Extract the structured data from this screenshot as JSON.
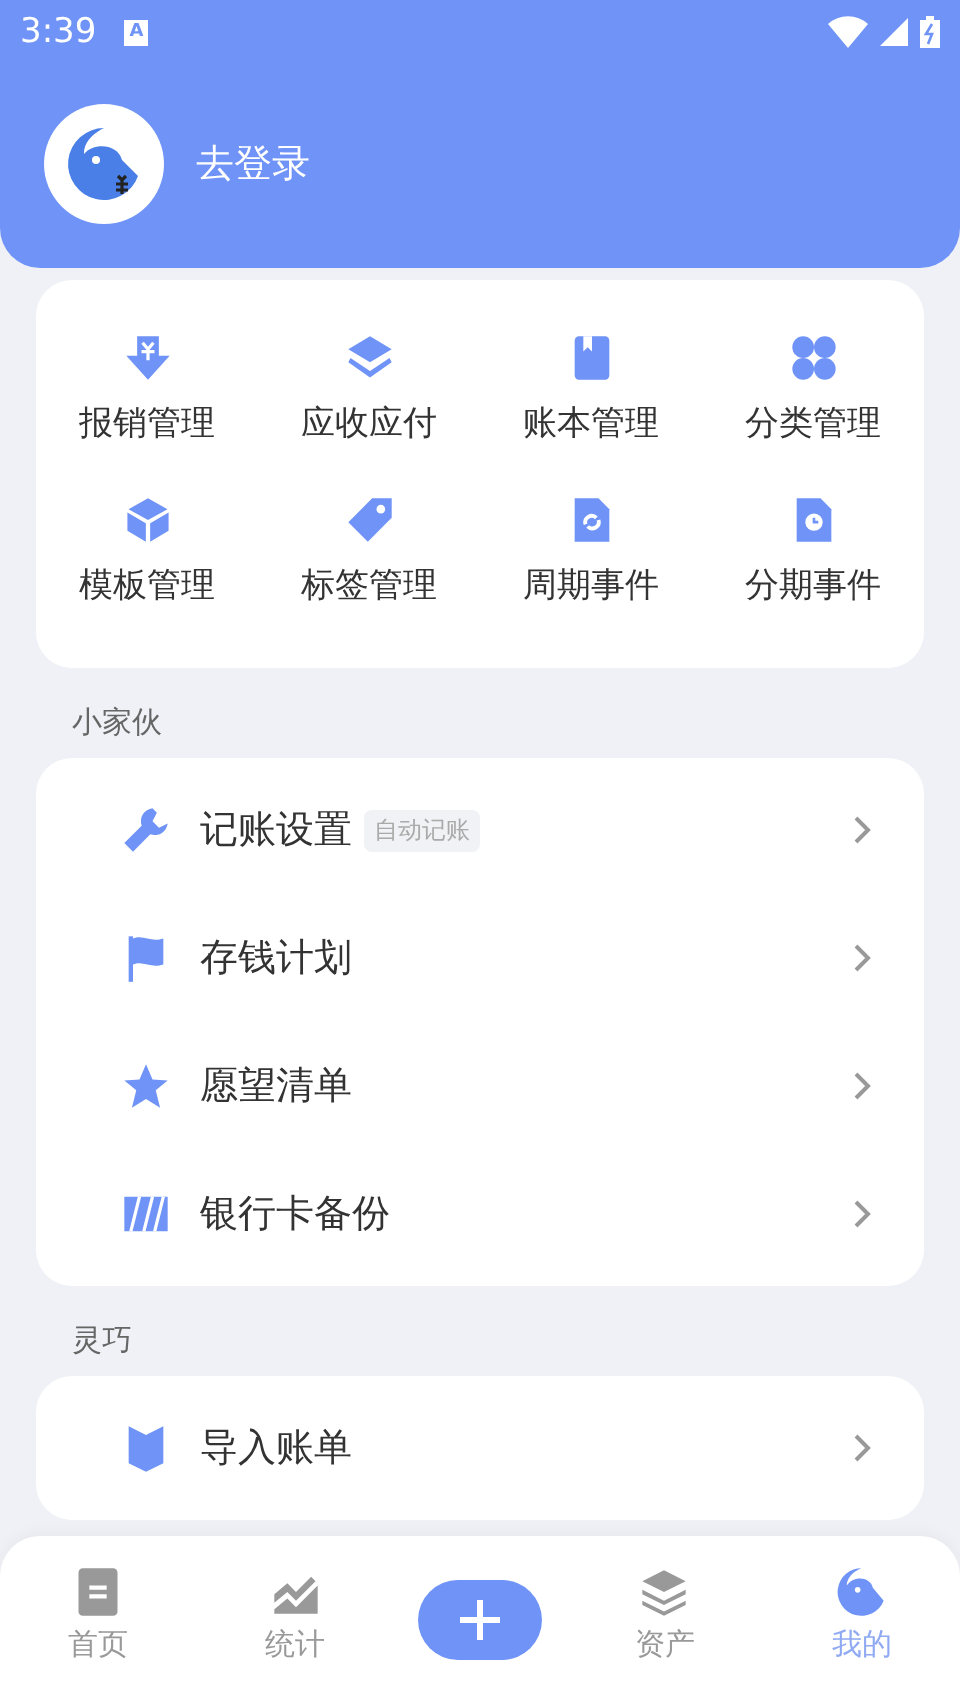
{
  "status_bar": {
    "time": "3:39",
    "notification": "A"
  },
  "profile": {
    "login_label": "去登录"
  },
  "shortcuts": [
    {
      "label": "报销管理",
      "kind": "reimburse"
    },
    {
      "label": "应收应付",
      "kind": "layers"
    },
    {
      "label": "账本管理",
      "kind": "book"
    },
    {
      "label": "分类管理",
      "kind": "clover"
    },
    {
      "label": "模板管理",
      "kind": "cube"
    },
    {
      "label": "标签管理",
      "kind": "tag"
    },
    {
      "label": "周期事件",
      "kind": "cycle"
    },
    {
      "label": "分期事件",
      "kind": "clock"
    }
  ],
  "sections": [
    {
      "title": "小家伙",
      "items": [
        {
          "label": "记账设置",
          "badge": "自动记账",
          "kind": "wrench"
        },
        {
          "label": "存钱计划",
          "kind": "flag"
        },
        {
          "label": "愿望清单",
          "kind": "star"
        },
        {
          "label": "银行卡备份",
          "kind": "cards"
        }
      ]
    },
    {
      "title": "灵巧",
      "items": [
        {
          "label": "导入账单",
          "kind": "shield"
        }
      ]
    }
  ],
  "tabs": [
    {
      "label": "首页",
      "kind": "home",
      "selected": false
    },
    {
      "label": "统计",
      "kind": "chart",
      "selected": false
    },
    {
      "kind": "add",
      "selected": false
    },
    {
      "label": "资产",
      "kind": "layers",
      "selected": false
    },
    {
      "label": "我的",
      "kind": "mine",
      "selected": true
    }
  ]
}
